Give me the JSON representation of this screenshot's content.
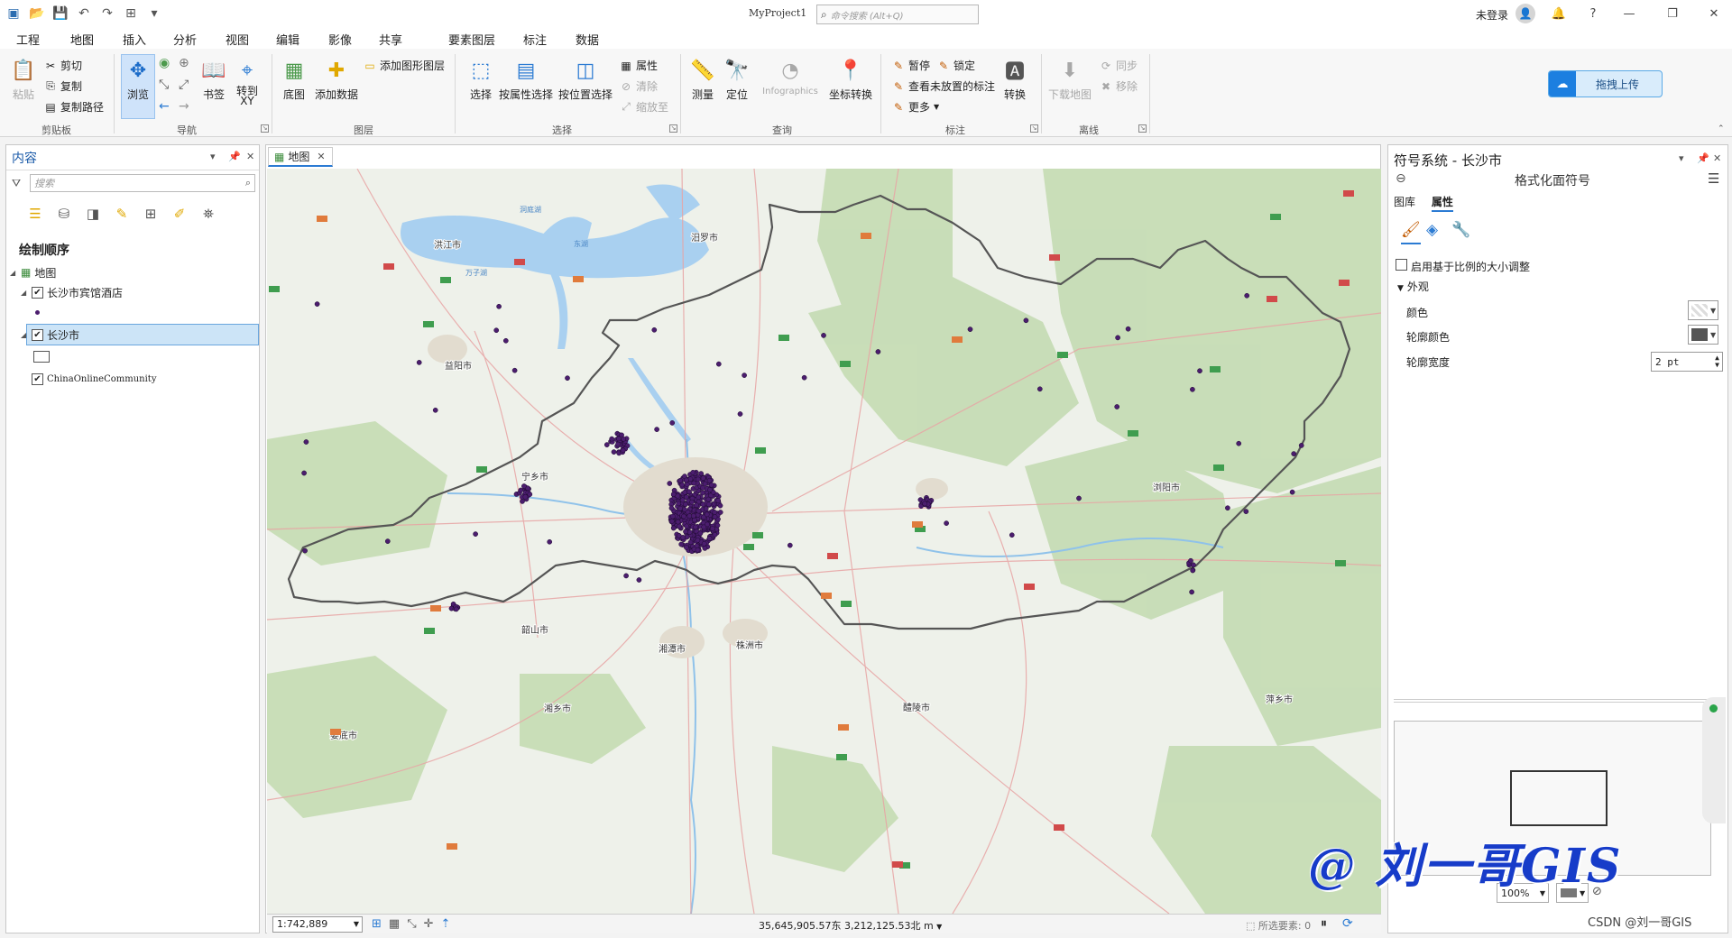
{
  "window": {
    "title": "MyProject1",
    "command_search_placeholder": "命令搜索 (Alt+Q)",
    "signin": "未登录",
    "controls": [
      "minimize",
      "restore",
      "close"
    ]
  },
  "ribbon_tabs": [
    "工程",
    "地图",
    "插入",
    "分析",
    "视图",
    "编辑",
    "影像",
    "共享",
    "要素图层",
    "标注",
    "数据"
  ],
  "active_tab": "地图",
  "ribbon": {
    "clipboard": {
      "paste": "粘贴",
      "cut": "剪切",
      "copy": "复制",
      "copy_path": "复制路径",
      "label": "剪贴板"
    },
    "navigate": {
      "explore": "浏览",
      "bookmarks": "书签",
      "goto_xy": "转到\nXY",
      "label": "导航"
    },
    "layer": {
      "basemap": "底图",
      "add_data": "添加数据",
      "add_graphics": "添加图形图层",
      "label": "图层"
    },
    "selection": {
      "select": "选择",
      "by_attr": "按属性选择",
      "by_loc": "按位置选择",
      "attributes": "属性",
      "clear": "清除",
      "zoom_to": "缩放至",
      "label": "选择"
    },
    "inquiry": {
      "measure": "测量",
      "locate": "定位",
      "infographics": "Infographics",
      "convert_coords": "坐标转换",
      "label": "查询"
    },
    "labeling": {
      "pause": "暂停",
      "lock": "锁定",
      "view_unplaced": "查看未放置的标注",
      "more": "更多",
      "convert": "转换",
      "label": "标注"
    },
    "offline": {
      "download_map": "下载地图",
      "sync": "同步",
      "remove": "移除",
      "label": "离线"
    },
    "upload_button": "拖拽上传"
  },
  "contents_pane": {
    "title": "内容",
    "search_placeholder": "搜索",
    "drawing_order": "绘制顺序",
    "map_name": "地图",
    "layers": [
      {
        "name": "长沙市宾馆酒店",
        "checked": true
      },
      {
        "name": "长沙市",
        "checked": true,
        "selected": true
      },
      {
        "name": "ChinaOnlineCommunity",
        "checked": true
      }
    ]
  },
  "map_view": {
    "tab_label": "地图",
    "scale": "1:742,889",
    "coordinates": "35,645,905.57东 3,212,125.53北 m",
    "selected_features_label": "所选要素:",
    "selected_features_count": "0",
    "city_labels": [
      "长沙市",
      "宁乡市",
      "浏阳市",
      "湘潭市",
      "株洲市",
      "益阳市",
      "韶山市",
      "湘乡市",
      "醴陵市",
      "萍乡市",
      "娄底市",
      "汨罗市",
      "洪江市"
    ],
    "water_labels": [
      "洞庭湖",
      "东湖",
      "万子湖"
    ]
  },
  "symbology_pane": {
    "title": "符号系统 - 长沙市",
    "subtitle": "格式化面符号",
    "tabs": [
      "图库",
      "属性"
    ],
    "active_tab": "属性",
    "scale_based_sizing": "启用基于比例的大小调整",
    "appearance_heading": "外观",
    "color_label": "颜色",
    "outline_color_label": "轮廓颜色",
    "outline_width_label": "轮廓宽度",
    "outline_width_value": "2 pt",
    "outline_color": "#555555",
    "overview_zoom": "100%"
  },
  "watermark": "@ 刘一哥GIS",
  "csdn_credit": "CSDN @刘一哥GIS",
  "colors": {
    "accent": "#2b7bd3",
    "points": "#4b1d6e",
    "boundary": "#555555",
    "forest": "#b9d5a8",
    "water": "#a9d0f0"
  }
}
